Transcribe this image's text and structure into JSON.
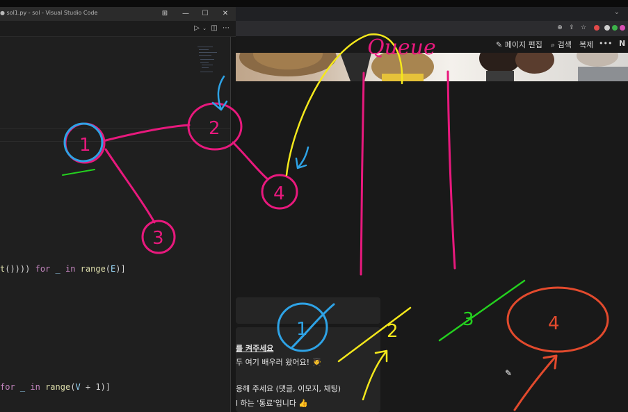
{
  "vscode": {
    "title": "● sol1.py - sol - Visual Studio Code",
    "layout_icon": "layout-icon",
    "minimize_icon": "minimize-icon",
    "maximize_icon": "maximize-icon",
    "close_icon": "close-icon",
    "run_icon": "play-icon",
    "split_icon": "split-editor-icon",
    "more_icon": "more-icon",
    "code": {
      "line1_tail": "t()))) for _ in range(E)]",
      "line2_tail": "for _ in range(V + 1)]"
    }
  },
  "browser": {
    "toolbar_icons": [
      "zoom-icon",
      "share-icon",
      "star-icon",
      "extension-icon",
      "extension-icon",
      "extension-icon",
      "extension-icon"
    ],
    "chevron": "⌄"
  },
  "notion": {
    "edit_page": "페이지 편집",
    "search": "검색",
    "duplicate": "복제",
    "more": "•••",
    "callout_lines": [
      "를 켜주세요",
      "두 여기 배우러 왔어요!",
      "응해 주세요 (댓글, 이모지, 채팅)",
      "l 하는 '통료'입니다"
    ],
    "bold_word": "통료"
  },
  "annotations": {
    "queue_word": "Queue",
    "nodes": [
      "1",
      "2",
      "3",
      "4"
    ],
    "queue_items": [
      "1",
      "2",
      "3",
      "4"
    ]
  }
}
